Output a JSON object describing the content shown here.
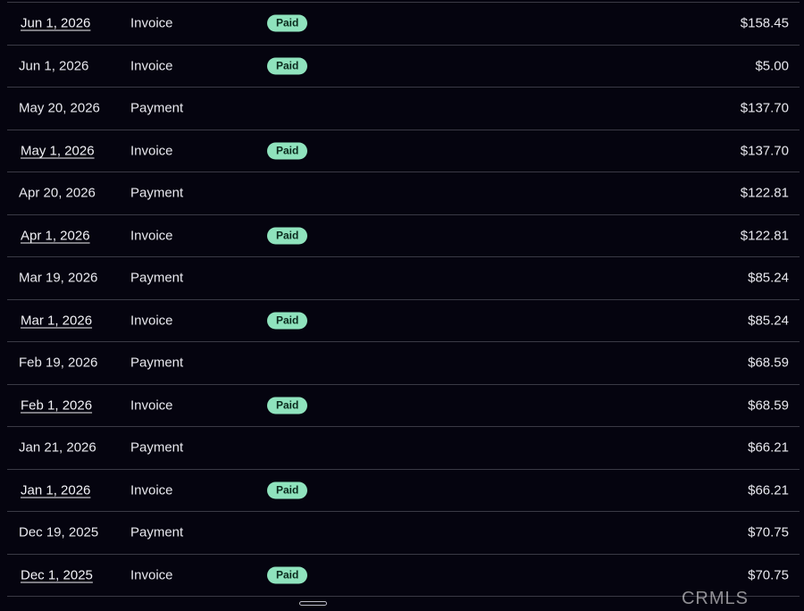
{
  "rows": [
    {
      "date": "Jun 1, 2026",
      "type": "Invoice",
      "status": "Paid",
      "amount": "$158.45",
      "link": true
    },
    {
      "date": "Jun 1, 2026",
      "type": "Invoice",
      "status": "Paid",
      "amount": "$5.00",
      "link": false
    },
    {
      "date": "May 20, 2026",
      "type": "Payment",
      "status": "",
      "amount": "$137.70",
      "link": false
    },
    {
      "date": "May 1, 2026",
      "type": "Invoice",
      "status": "Paid",
      "amount": "$137.70",
      "link": true
    },
    {
      "date": "Apr 20, 2026",
      "type": "Payment",
      "status": "",
      "amount": "$122.81",
      "link": false
    },
    {
      "date": "Apr 1, 2026",
      "type": "Invoice",
      "status": "Paid",
      "amount": "$122.81",
      "link": true
    },
    {
      "date": "Mar 19, 2026",
      "type": "Payment",
      "status": "",
      "amount": "$85.24",
      "link": false
    },
    {
      "date": "Mar 1, 2026",
      "type": "Invoice",
      "status": "Paid",
      "amount": "$85.24",
      "link": true
    },
    {
      "date": "Feb 19, 2026",
      "type": "Payment",
      "status": "",
      "amount": "$68.59",
      "link": false
    },
    {
      "date": "Feb 1, 2026",
      "type": "Invoice",
      "status": "Paid",
      "amount": "$68.59",
      "link": true
    },
    {
      "date": "Jan 21, 2026",
      "type": "Payment",
      "status": "",
      "amount": "$66.21",
      "link": false
    },
    {
      "date": "Jan 1, 2026",
      "type": "Invoice",
      "status": "Paid",
      "amount": "$66.21",
      "link": true
    },
    {
      "date": "Dec 19, 2025",
      "type": "Payment",
      "status": "",
      "amount": "$70.75",
      "link": false
    },
    {
      "date": "Dec 1, 2025",
      "type": "Invoice",
      "status": "Paid",
      "amount": "$70.75",
      "link": true
    }
  ],
  "watermark": "CRMLS",
  "colors": {
    "background": "#05040f",
    "paid_badge": "#8fe3bd",
    "divider": "#3a3a45"
  }
}
